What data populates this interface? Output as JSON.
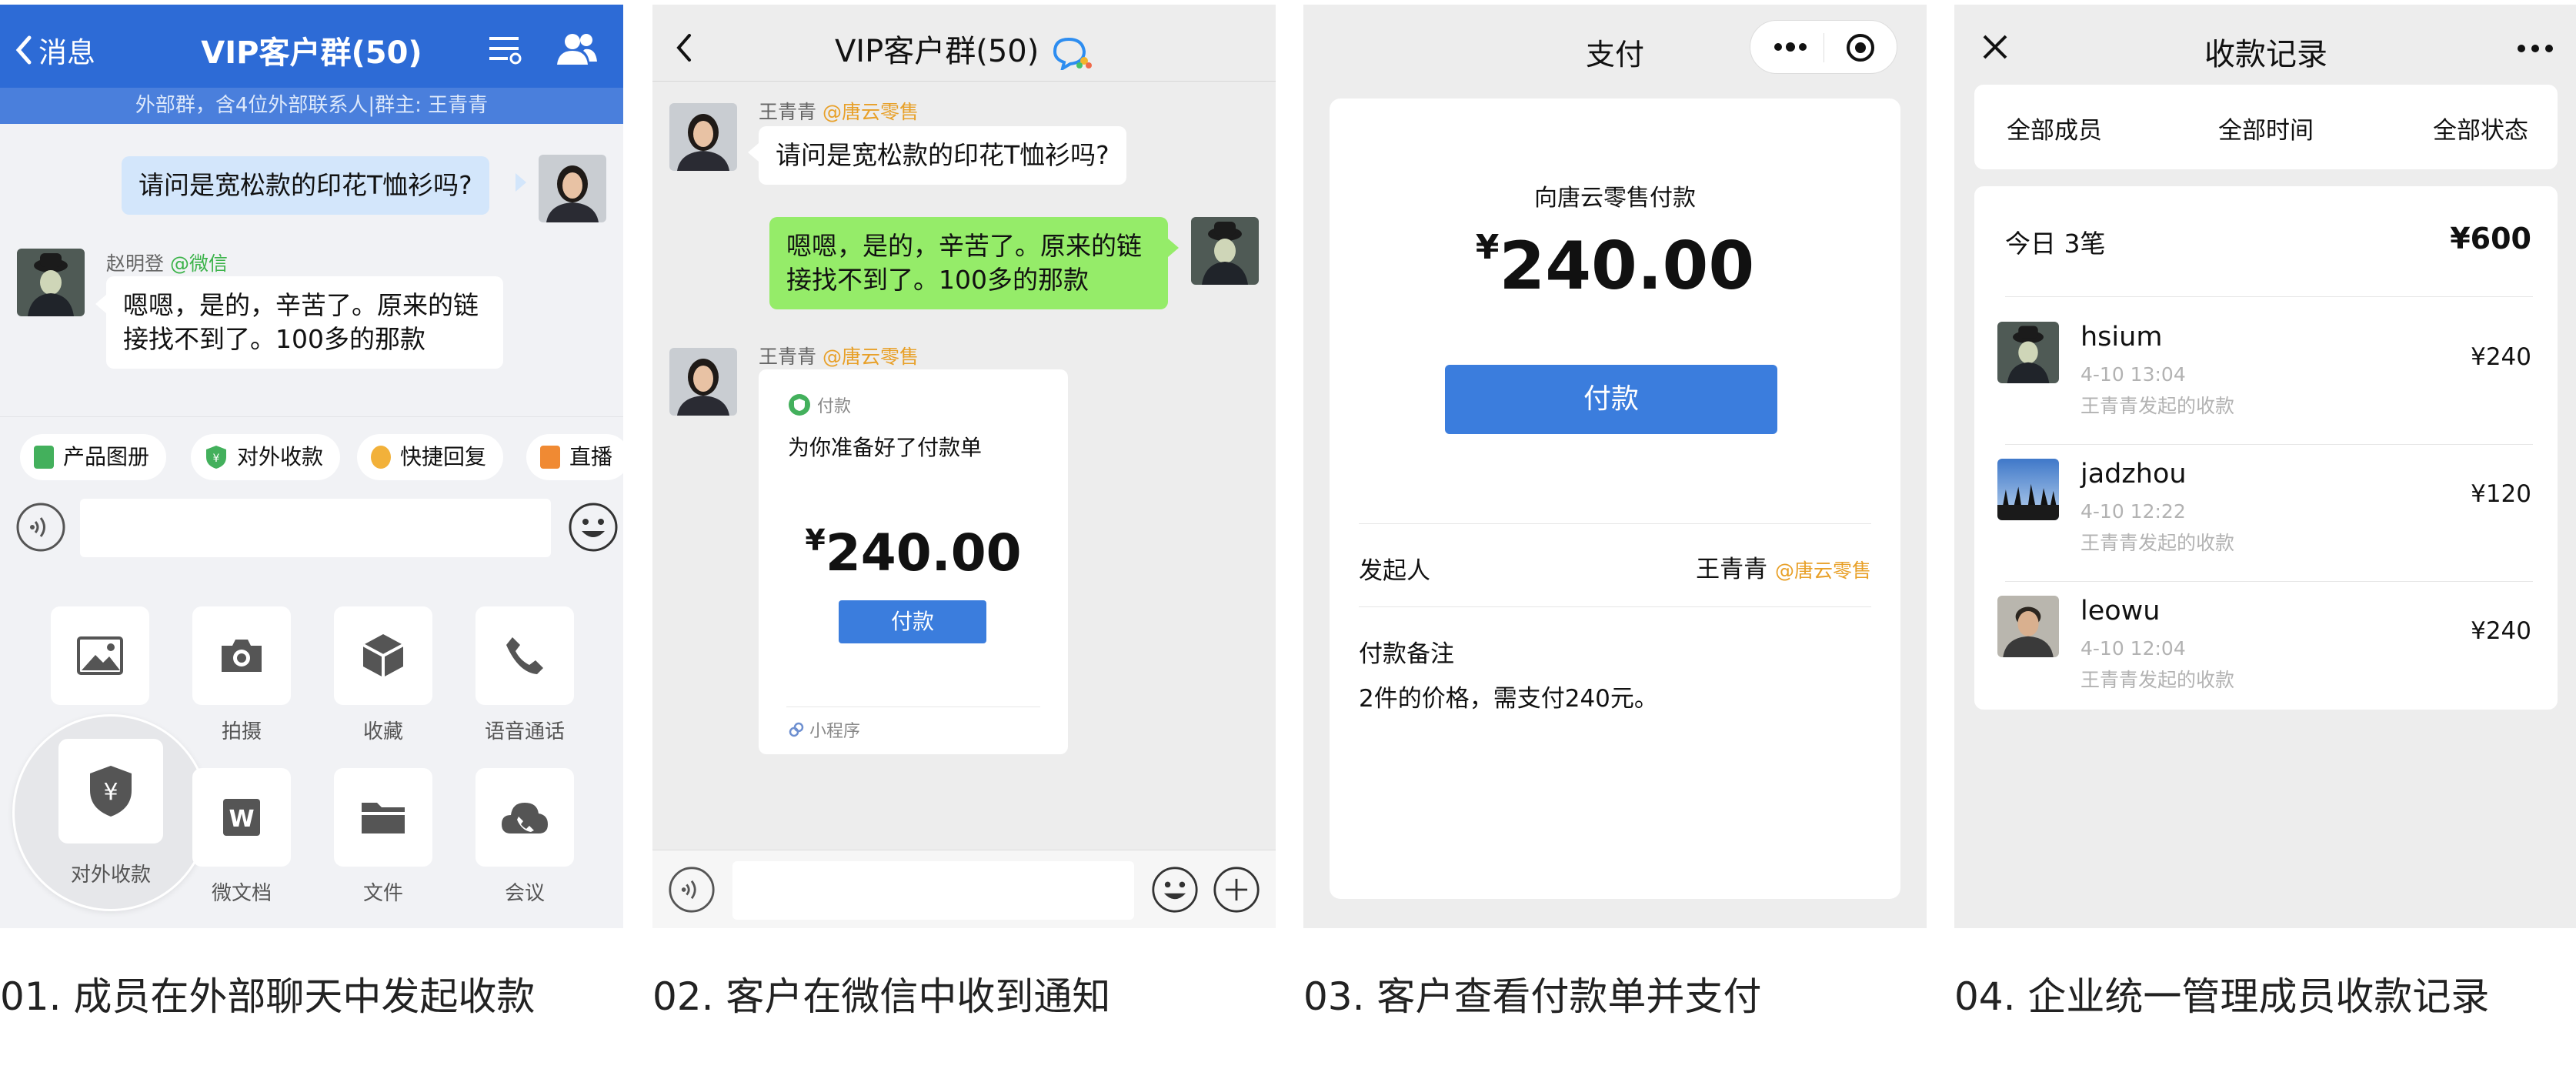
{
  "screen1": {
    "back_label": "消息",
    "title": "VIP客户群(50)",
    "notice": "外部群，含4位外部联系人|群主: 王青青",
    "msg_out": "请问是宽松款的印花T恤衫吗?",
    "reply_sender": "赵明登",
    "reply_sender_org": "@微信",
    "reply_text": "嗯嗯，是的，辛苦了。原来的链接找不到了。100多的那款",
    "chips": [
      "产品图册",
      "对外收款",
      "快捷回复",
      "直播"
    ],
    "tools": {
      "photo": "拍摄",
      "favorites": "收藏",
      "voice_call": "语音通话",
      "collect_payment": "对外收款",
      "doc": "微文档",
      "file": "文件",
      "meeting": "会议"
    }
  },
  "screen2": {
    "title": "VIP客户群(50)",
    "sender1": "王青青",
    "sender1_org": "@唐云零售",
    "msg1": "请问是宽松款的印花T恤衫吗?",
    "msg2": "嗯嗯，是的，辛苦了。原来的链接找不到了。100多的那款",
    "sender2": "王青青",
    "sender2_org": "@唐云零售",
    "card_tag": "付款",
    "card_desc": "为你准备好了付款单",
    "currency": "¥",
    "amount": "240.00",
    "pay_button": "付款",
    "mini_program": "小程序"
  },
  "screen3": {
    "title": "支付",
    "payee": "向唐云零售付款",
    "currency": "¥",
    "amount": "240.00",
    "pay_button": "付款",
    "initiator_label": "发起人",
    "initiator_name": "王青青",
    "initiator_org": "@唐云零售",
    "note_label": "付款备注",
    "note_text": "2件的价格，需支付240元。"
  },
  "screen4": {
    "title": "收款记录",
    "filters": [
      "全部成员",
      "全部时间",
      "全部状态"
    ],
    "summary_label": "今日 3笔",
    "summary_amount": "¥600",
    "records": [
      {
        "name": "hsium",
        "time": "4-10 13:04",
        "by": "王青青发起的收款",
        "amount": "¥240"
      },
      {
        "name": "jadzhou",
        "time": "4-10 12:22",
        "by": "王青青发起的收款",
        "amount": "¥120"
      },
      {
        "name": "leowu",
        "time": "4-10 12:04",
        "by": "王青青发起的收款",
        "amount": "¥240"
      }
    ]
  },
  "captions": [
    "01. 成员在外部聊天中发起收款",
    "02. 客户在微信中收到通知",
    "03. 客户查看付款单并支付",
    "04. 企业统一管理成员收款记录"
  ],
  "colors": {
    "work_blue": "#2d6bd6",
    "pay_blue": "#3b7ddd",
    "wechat_green": "#95ec69",
    "org_orange": "#e8a028"
  }
}
